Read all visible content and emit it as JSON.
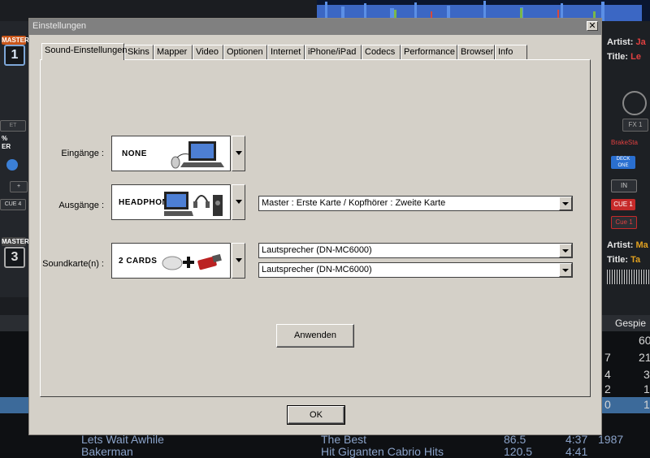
{
  "background": {
    "left_deck": {
      "master_label": "MASTER",
      "deck_top": "1",
      "deck_bottom": "3",
      "set_label": "ET",
      "pct_label": "%",
      "er_label": "ER",
      "cue_label": "CUE 4"
    },
    "right_deck_top": {
      "artist_label": "Artist:",
      "artist_value": "Ja",
      "title_label": "Title:",
      "title_value": "Le",
      "fx_label": "FX 1",
      "brake_label": "BrakeSta",
      "deck_label": "DECK ONE",
      "in_label": "IN",
      "cue_big": "CUE 1",
      "cue_small": "Cue 1"
    },
    "right_deck_bottom": {
      "artist_label": "Artist:",
      "artist_value": "Ma",
      "title_label": "Title:",
      "title_value": "Ta"
    },
    "browser_header": "Gespie",
    "browser_rows": [
      {
        "a": "",
        "b": "60"
      },
      {
        "a": "7",
        "b": "21"
      },
      {
        "a": "4",
        "b": "3"
      },
      {
        "a": "2",
        "b": "1"
      },
      {
        "a": "0",
        "b": "1"
      }
    ],
    "bottom_rows": [
      {
        "title": "Lets Wait Awhile",
        "album": "The Best",
        "bpm": "86.5",
        "length": "4:37",
        "year": "1987"
      },
      {
        "title": "Bakerman",
        "album": "Hit Giganten Cabrio Hits",
        "bpm": "120.5",
        "length": "4:41",
        "year": ""
      }
    ]
  },
  "dialog": {
    "title": "Einstellungen",
    "close_glyph": "✕",
    "tabs": [
      "Sound-Einstellungen",
      "Skins",
      "Mapper",
      "Video",
      "Optionen",
      "Internet",
      "iPhone/iPad",
      "Codecs",
      "Performance",
      "Browser",
      "Info"
    ],
    "active_tab": "Sound-Einstellungen",
    "inputs": {
      "label": "Eingänge :",
      "image_word": "NONE"
    },
    "outputs": {
      "label": "Ausgänge :",
      "image_word": "HEADPHONES",
      "select_value": "Master : Erste Karte / Kopfhörer : Zweite Karte"
    },
    "soundcards": {
      "label": "Soundkarte(n) :",
      "image_word": "2 CARDS",
      "select1_value": "Lautsprecher (DN-MC6000)",
      "select2_value": "Lautsprecher (DN-MC6000)"
    },
    "apply_label": "Anwenden",
    "ok_label": "OK"
  },
  "colors": {
    "dialog_bg": "#d4d0c8",
    "titlebar": "#808080",
    "accent_orange": "#c9561a",
    "selected_row": "#3c6a9a"
  }
}
